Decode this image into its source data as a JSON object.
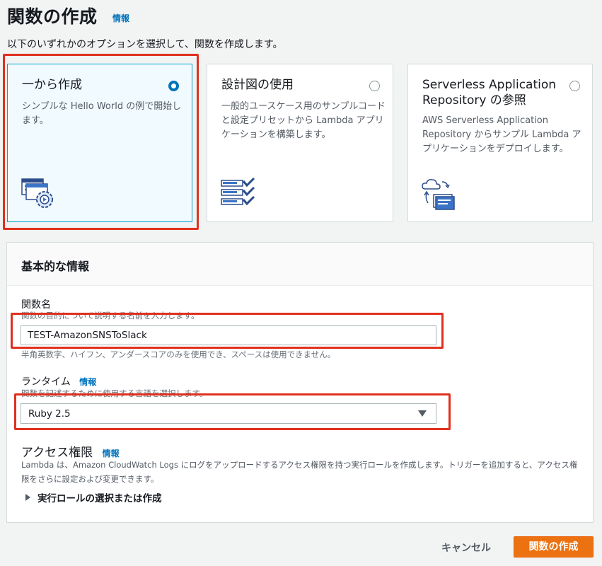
{
  "page": {
    "title": "関数の作成",
    "title_info": "情報",
    "description": "以下のいずれかのオプションを選択して、関数を作成します。"
  },
  "options": [
    {
      "title": "一から作成",
      "description": "シンプルな Hello World の例で開始します。",
      "selected": true,
      "icon": "author-from-scratch-icon"
    },
    {
      "title": "設計図の使用",
      "description": "一般的ユースケース用のサンプルコードと設定プリセットから Lambda アプリケーションを構築します。",
      "selected": false,
      "icon": "blueprint-icon"
    },
    {
      "title": "Serverless Application Repository の参照",
      "description": "AWS Serverless Application Repository からサンプル Lambda アプリケーションをデプロイします。",
      "selected": false,
      "icon": "serverless-repo-icon"
    }
  ],
  "basic_info": {
    "heading": "基本的な情報",
    "function_name": {
      "label": "関数名",
      "hint": "関数の目的について説明する名前を入力します。",
      "value": "TEST-AmazonSNSToSlack",
      "constraint": "半角英数字、ハイフン、アンダースコアのみを使用でき、スペースは使用できません。"
    },
    "runtime": {
      "label": "ランタイム",
      "info": "情報",
      "hint": "関数を記述するために使用する言語を選択します。",
      "value": "Ruby 2.5"
    },
    "access": {
      "heading": "アクセス権限",
      "info": "情報",
      "description": "Lambda は、Amazon CloudWatch Logs にログをアップロードするアクセス権限を持つ実行ロールを作成します。トリガーを追加すると、アクセス権限をさらに設定および変更できます。",
      "expander": "実行ロールの選択または作成"
    }
  },
  "footer": {
    "cancel": "キャンセル",
    "create": "関数の作成"
  },
  "colors": {
    "accent": "#0073bb",
    "primary_button": "#ec7211",
    "highlight": "#e0301e",
    "selected_card": "#f1faff"
  }
}
